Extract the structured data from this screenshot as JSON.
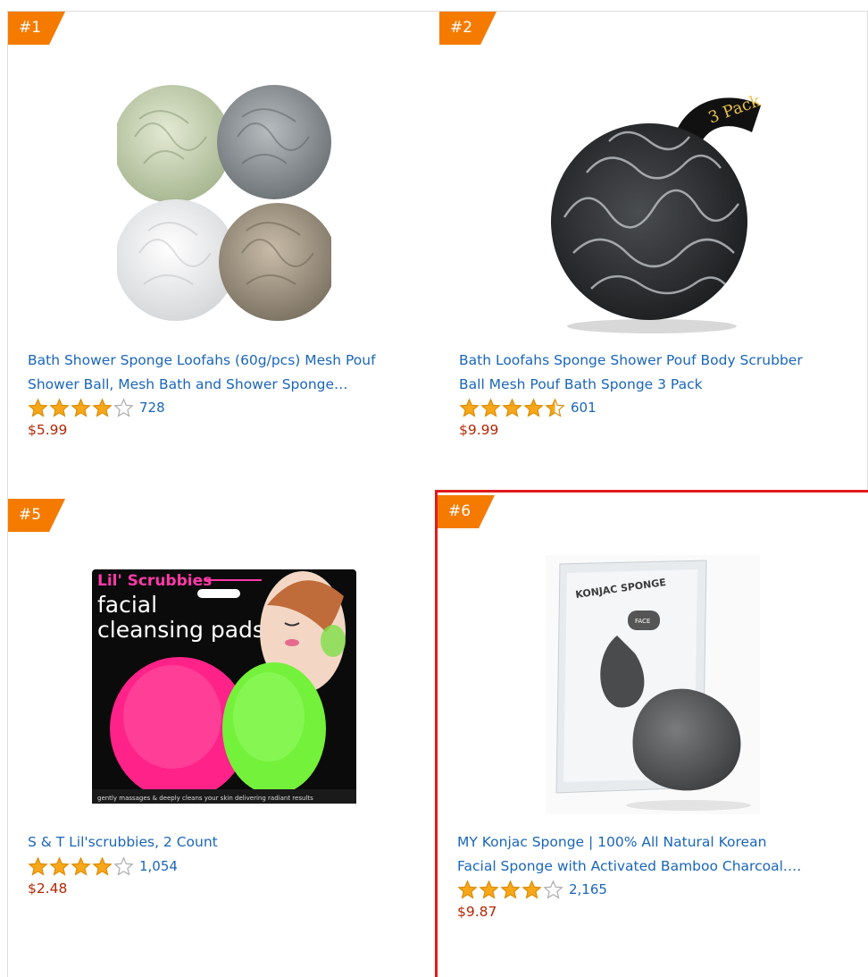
{
  "products": [
    {
      "rank": "#1",
      "title_line1": "Bath Shower Sponge Loofahs (60g/pcs) Mesh Pouf",
      "title_line2": "Shower Ball, Mesh Bath and Shower Sponge…",
      "rating": 4,
      "reviews": "728",
      "price": "$5.99"
    },
    {
      "rank": "#2",
      "title_line1": "Bath Loofahs Sponge Shower Pouf Body Scrubber",
      "title_line2": "Ball Mesh Pouf Bath Sponge 3 Pack",
      "rating": 4.5,
      "reviews": "601",
      "price": "$9.99",
      "strap_text": "3 Pack"
    },
    {
      "rank": "#5",
      "title_line1": "S & T Lil'scrubbies, 2 Count",
      "title_line2": "",
      "rating": 4,
      "reviews": "1,054",
      "price": "$2.48",
      "pack_brand": "Lil' Scrubbies",
      "pack_line1": "facial",
      "pack_line2": "cleansing pads",
      "pack_footer": "gently massages & deeply cleans your skin delivering radiant results"
    },
    {
      "rank": "#6",
      "title_line1": "MY Konjac Sponge | 100% All Natural Korean",
      "title_line2": "Facial Sponge with Activated Bamboo Charcoal.…",
      "rating": 4,
      "reviews": "2,165",
      "price": "$9.87",
      "pack_label": "KONJAC SPONGE",
      "pack_face": "FACE"
    }
  ],
  "colors": {
    "rank_badge": "#f47b00",
    "link": "#1a66b8",
    "price": "#b12704",
    "star_fill": "#f8a71b",
    "selection_border": "#e01b1b"
  }
}
